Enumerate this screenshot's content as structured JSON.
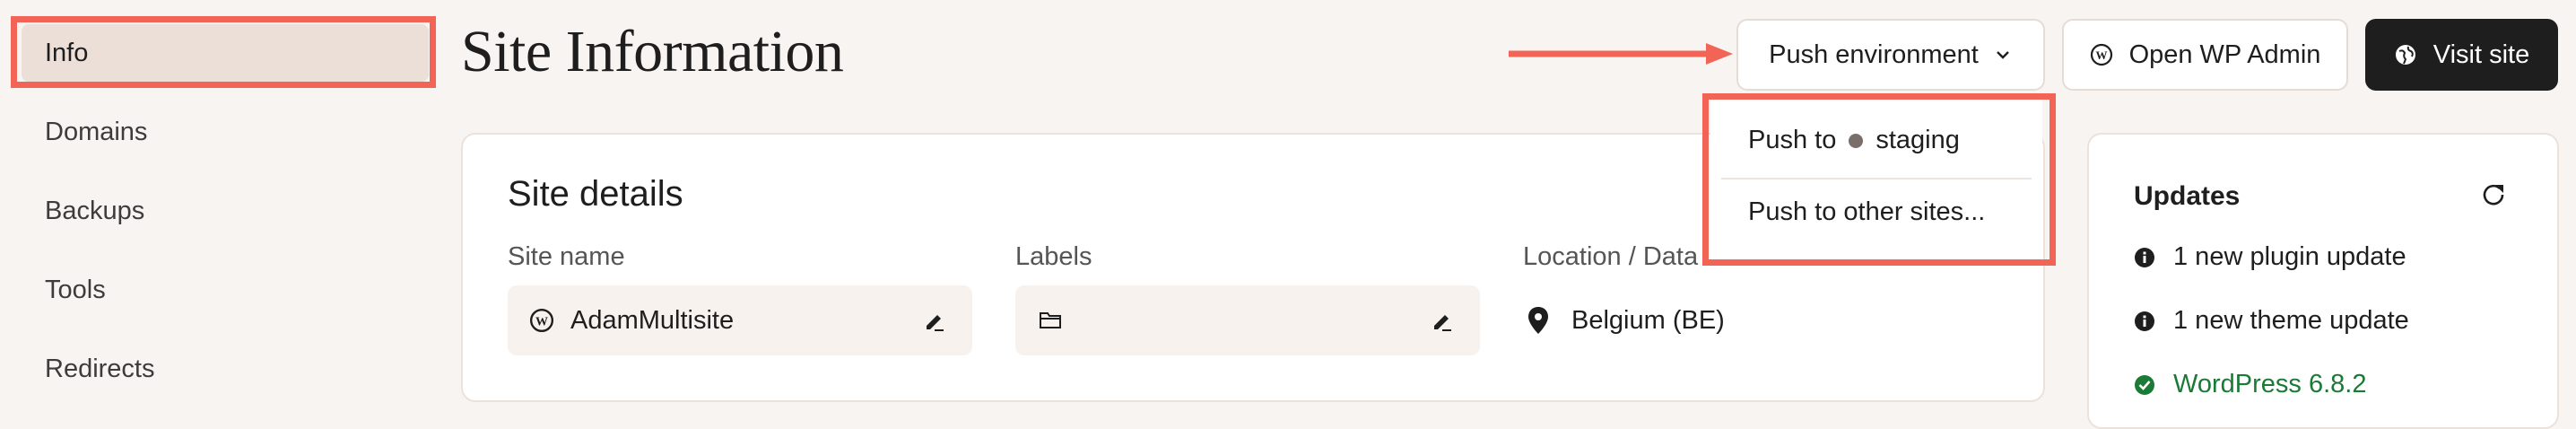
{
  "sidebar": {
    "items": [
      {
        "label": "Info",
        "active": true
      },
      {
        "label": "Domains"
      },
      {
        "label": "Backups"
      },
      {
        "label": "Tools"
      },
      {
        "label": "Redirects"
      }
    ]
  },
  "header": {
    "title": "Site Information",
    "push_label": "Push environment",
    "admin_label": "Open WP Admin",
    "visit_label": "Visit site"
  },
  "dropdown": {
    "push_to_prefix": "Push to",
    "push_to_env": "staging",
    "other_sites": "Push to other sites..."
  },
  "site_details": {
    "title": "Site details",
    "site_name_label": "Site name",
    "site_name_value": "AdamMultisite",
    "labels_label": "Labels",
    "labels_value": "",
    "location_label": "Location / Data",
    "location_value": "Belgium (BE)"
  },
  "updates": {
    "title": "Updates",
    "plugin": "1 new plugin update",
    "theme": "1 new theme update",
    "wordpress": "WordPress 6.8.2"
  },
  "colors": {
    "background": "#f8f4f1",
    "highlight": "#f16456",
    "active_nav": "#ecdfd8",
    "primary_button": "#1e1e1e",
    "success": "#1b7a36"
  },
  "icons": [
    "wordpress-icon",
    "globe-icon",
    "chevron-down-icon",
    "dot-icon",
    "folder-icon",
    "edit-icon",
    "location-pin-icon",
    "refresh-icon",
    "info-icon",
    "check-circle-icon",
    "arrow-right-icon"
  ]
}
